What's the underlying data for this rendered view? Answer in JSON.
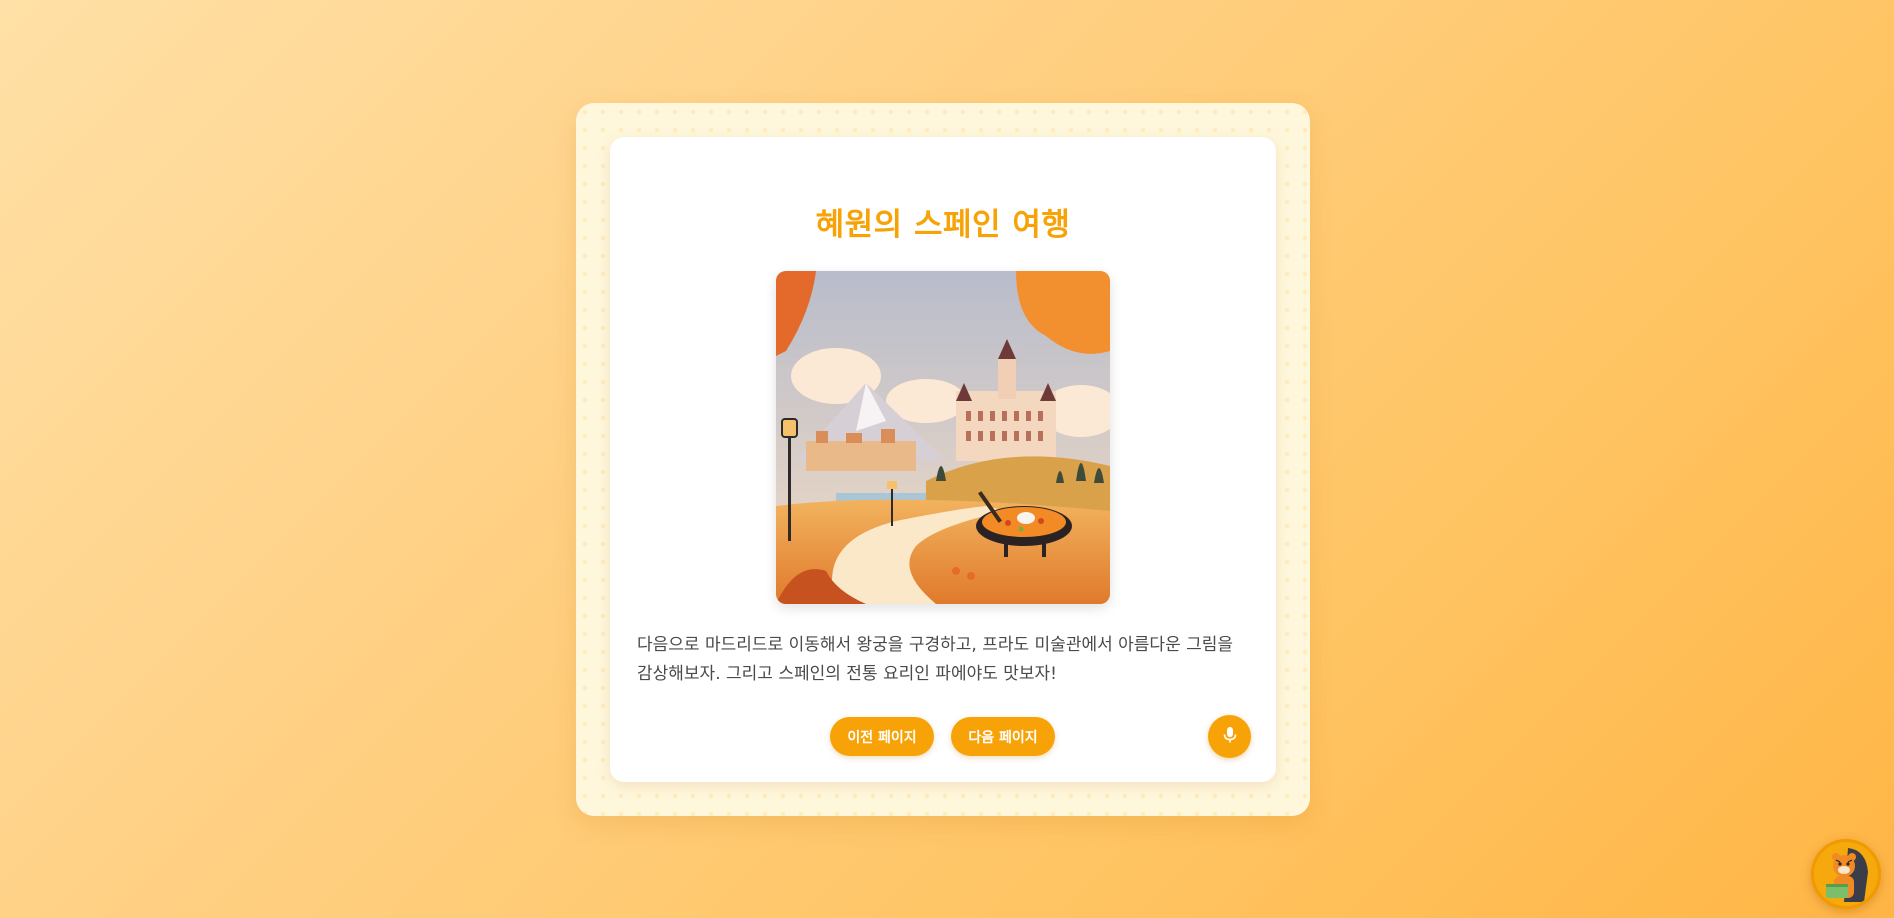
{
  "story": {
    "title": "혜원의 스페인 여행",
    "illustration_alt": "마드리드 왕궁과 파에야",
    "text": "다음으로 마드리드로 이동해서 왕궁을 구경하고, 프라도 미술관에서 아름다운 그림을 감상해보자. 그리고 스페인의 전통 요리인 파에야도 맛보자!"
  },
  "controls": {
    "prev_label": "이전 페이지",
    "next_label": "다음 페이지",
    "mic_icon": "microphone-icon"
  },
  "mascot": {
    "icon": "tiger-mascot-icon"
  },
  "colors": {
    "accent": "#f7a308",
    "text": "#4a4a4a",
    "card": "#ffffff",
    "frame": "#fff7dc"
  }
}
